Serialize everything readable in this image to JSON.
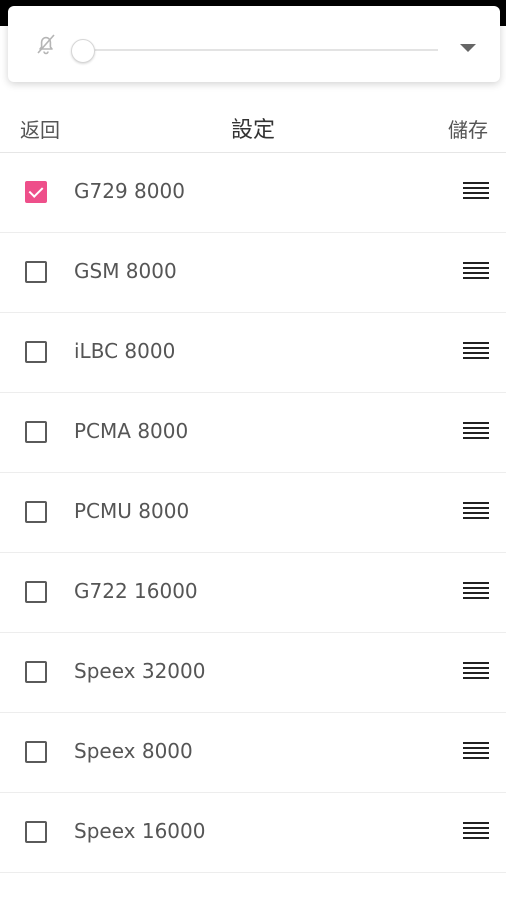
{
  "volume_panel": {
    "icons": {
      "mute": "bell-muted-icon",
      "expand": "chevron-down-icon"
    },
    "level": 0
  },
  "header": {
    "back_label": "返回",
    "title": "設定",
    "save_label": "儲存"
  },
  "codecs": [
    {
      "name": "G729 8000",
      "checked": true
    },
    {
      "name": "GSM 8000",
      "checked": false
    },
    {
      "name": "iLBC 8000",
      "checked": false
    },
    {
      "name": "PCMA 8000",
      "checked": false
    },
    {
      "name": "PCMU 8000",
      "checked": false
    },
    {
      "name": "G722 16000",
      "checked": false
    },
    {
      "name": "Speex 32000",
      "checked": false
    },
    {
      "name": "Speex 8000",
      "checked": false
    },
    {
      "name": "Speex 16000",
      "checked": false
    }
  ],
  "colors": {
    "accent": "#ee4f8a",
    "text": "#555555",
    "divider": "#ededed"
  }
}
